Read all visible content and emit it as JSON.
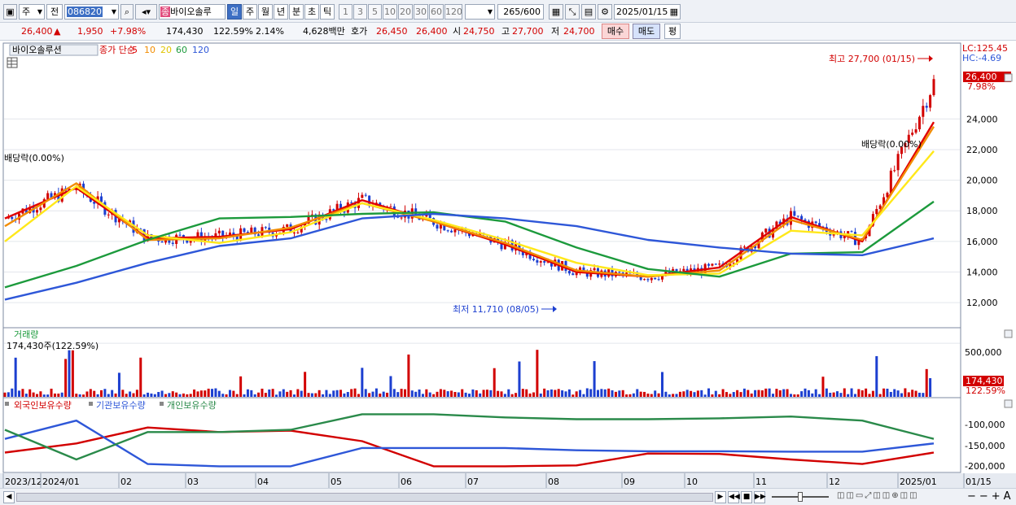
{
  "toolbar": {
    "period_select": "주",
    "mode_select": "전",
    "code": "086820",
    "stock_tag": "종",
    "stock_name": "바이오솔루",
    "period_tabs": [
      "일",
      "주",
      "월",
      "년",
      "분",
      "초",
      "틱"
    ],
    "active_period": "일",
    "intervals": [
      "1",
      "3",
      "5",
      "10",
      "20",
      "30",
      "60",
      "120"
    ],
    "count": "265",
    "count_total": "/600",
    "date": "2025/01/15"
  },
  "quote": {
    "price": "26,400",
    "arrow": "▲",
    "change": "1,950",
    "change_pct": "+7.98%",
    "volume": "174,430",
    "volume_ratio": "122.59%",
    "turnover": "2.14%",
    "amount": "4,628백만",
    "bid_label": "호가",
    "bid_high": "26,450",
    "bid_low": "26,400",
    "open_label": "시",
    "open": "24,750",
    "high_label": "고",
    "high": "27,700",
    "low_label": "저",
    "low": "24,700",
    "buy_button": "매수",
    "sell_button": "매도",
    "eval_button": "평"
  },
  "price_panel": {
    "title": "바이오솔루션",
    "legend_label": "종가 단순",
    "ma_periods": [
      "5",
      "10",
      "20",
      "60",
      "120"
    ],
    "ma_colors": [
      "#e00000",
      "#f28c00",
      "#ffe81a",
      "#1c9a3c",
      "#2e57d8"
    ],
    "lc": "LC:125.45",
    "hc": "HC:-4.69",
    "max_label": "최고 27,700 (01/15)",
    "min_label": "최저 11,710 (08/05)",
    "dividend_label_1": "배당락(0.00%)",
    "dividend_label_2": "배당락(0.00%)",
    "current_price_tag": "26,400",
    "current_pct_tag": "7.98%",
    "y_ticks": [
      "24,000",
      "22,000",
      "20,000",
      "18,000",
      "16,000",
      "14,000",
      "12,000"
    ]
  },
  "volume_panel": {
    "title": "거래량",
    "value": "174,430주(122.59%)",
    "y_ticks": [
      "500,000",
      "0"
    ],
    "current_tag": "174,430",
    "current_pct": "122.59%"
  },
  "holding_panel": {
    "legend": [
      "외국인보유수량",
      "기관보유수량",
      "개인보유수량"
    ],
    "colors": [
      "#d20000",
      "#2e57d8",
      "#2a8a4a"
    ],
    "y_ticks": [
      "-100,000",
      "-150,000",
      "-200,000"
    ]
  },
  "x_axis": {
    "labels": [
      "2023/12",
      "2024/01",
      "02",
      "03",
      "04",
      "05",
      "06",
      "07",
      "08",
      "09",
      "10",
      "11",
      "12",
      "2025/01",
      "01/15"
    ]
  },
  "chart_data": {
    "type": "candlestick",
    "title": "바이오솔루션",
    "ylim": [
      11000,
      28000
    ],
    "x": [
      "2023/12",
      "2024/01",
      "02",
      "03",
      "04",
      "05",
      "06",
      "07",
      "08",
      "09",
      "10",
      "11",
      "12",
      "2025/01"
    ],
    "close": [
      17500,
      19500,
      16200,
      16300,
      16800,
      18700,
      17300,
      15800,
      14000,
      13700,
      14300,
      17600,
      16000,
      26400
    ],
    "ma": [
      {
        "name": "5",
        "values": [
          17500,
          19500,
          16200,
          16300,
          16800,
          18700,
          17300,
          15800,
          14000,
          13700,
          14300,
          17600,
          16000,
          23800
        ]
      },
      {
        "name": "10",
        "values": [
          17000,
          19800,
          16100,
          16200,
          16900,
          18500,
          17300,
          15900,
          14100,
          13700,
          14100,
          17400,
          16100,
          23500
        ]
      },
      {
        "name": "20",
        "values": [
          16000,
          19600,
          16400,
          15900,
          16600,
          18500,
          17400,
          16100,
          14600,
          13800,
          13900,
          16700,
          16400,
          21900
        ]
      },
      {
        "name": "60",
        "values": [
          13000,
          14400,
          16100,
          17500,
          17600,
          17800,
          17900,
          17300,
          15600,
          14200,
          13700,
          15200,
          15300,
          18600
        ]
      },
      {
        "name": "120",
        "values": [
          12200,
          13300,
          14600,
          15700,
          16200,
          17500,
          17800,
          17500,
          17000,
          16100,
          15600,
          15200,
          15100,
          16200
        ]
      }
    ],
    "high_marker": {
      "value": 27700,
      "date": "01/15"
    },
    "low_marker": {
      "value": 11710,
      "date": "08/05"
    },
    "volume": {
      "last": 174430,
      "ylim": [
        0,
        600000
      ]
    },
    "holdings": {
      "ylim": [
        -210000,
        -80000
      ],
      "series": [
        {
          "name": "외국인보유수량",
          "values": [
            -170000,
            -150000,
            -115000,
            -125000,
            -122000,
            -145000,
            -200000,
            -200000,
            -198000,
            -172000,
            -173000,
            -185000,
            -195000,
            -170000
          ]
        },
        {
          "name": "기관보유수량",
          "values": [
            -140000,
            -100000,
            -195000,
            -200000,
            -200000,
            -160000,
            -160000,
            -160000,
            -165000,
            -167000,
            -167000,
            -168000,
            -168000,
            -150000
          ]
        },
        {
          "name": "개인보유수량",
          "values": [
            -120000,
            -185000,
            -125000,
            -125000,
            -120000,
            -86000,
            -86000,
            -93000,
            -97000,
            -97000,
            -95000,
            -91000,
            -100000,
            -140000
          ]
        }
      ]
    }
  }
}
